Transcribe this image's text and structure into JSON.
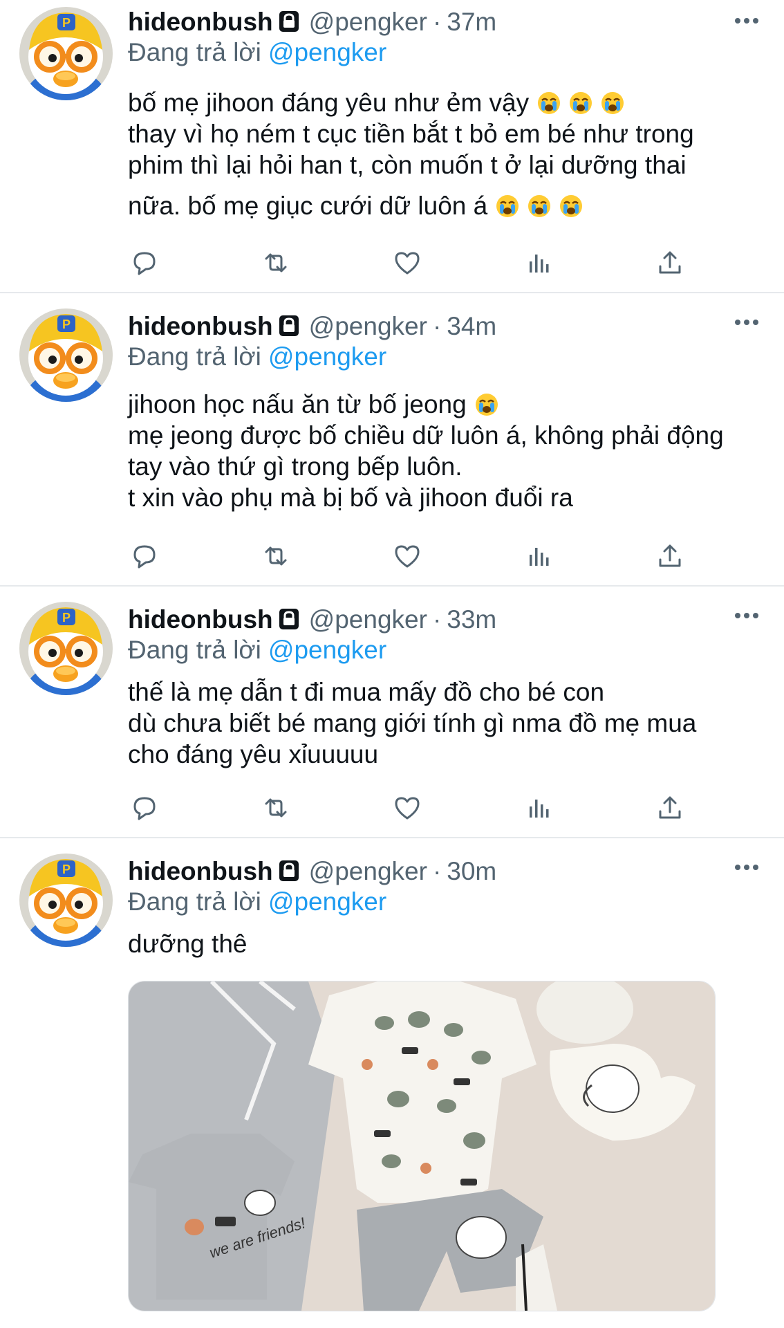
{
  "tweets": [
    {
      "name": "hideonbush",
      "handle": "@pengker",
      "time": "37m",
      "reply_prefix": "Đang trả lời",
      "reply_to": "@pengker",
      "lines": [
        "bố mẹ jihoon đáng yêu như ẻm vậy",
        "thay vì họ ném t cục tiền bắt t bỏ em bé như trong",
        "phim thì lại hỏi han t, còn muốn t ở lại dưỡng thai",
        "nữa. bố mẹ giục cưới dữ luôn á"
      ]
    },
    {
      "name": "hideonbush",
      "handle": "@pengker",
      "time": "34m",
      "reply_prefix": "Đang trả lời",
      "reply_to": "@pengker",
      "lines": [
        "jihoon học nấu ăn từ bố jeong",
        "mẹ jeong được bố chiều dữ luôn á, không phải động",
        "tay vào thứ gì trong bếp luôn.",
        "t xin vào phụ mà bị bố và jihoon đuổi ra"
      ]
    },
    {
      "name": "hideonbush",
      "handle": "@pengker",
      "time": "33m",
      "reply_prefix": "Đang trả lời",
      "reply_to": "@pengker",
      "lines": [
        "thế là mẹ dẫn t đi mua mấy đồ cho bé con",
        "dù chưa biết bé mang giới tính gì nma đồ mẹ mua",
        "cho đáng yêu xỉuuuuu"
      ]
    },
    {
      "name": "hideonbush",
      "handle": "@pengker",
      "time": "30m",
      "reply_prefix": "Đang trả lời",
      "reply_to": "@pengker",
      "lines": [
        "dưỡng thê"
      ],
      "media_text": "we are friends!"
    }
  ],
  "icons": {
    "avatar": "penguin-avatar-icon",
    "lock": "lock-icon",
    "more": "more-options-icon",
    "emoji": "loudly-crying-face-icon",
    "actions": [
      "reply-icon",
      "retweet-icon",
      "like-icon",
      "analytics-icon",
      "share-icon"
    ]
  },
  "colors": {
    "text": "#0f1419",
    "secondary": "#536471",
    "link": "#1d9bf0",
    "divider": "#e6e9ec"
  }
}
